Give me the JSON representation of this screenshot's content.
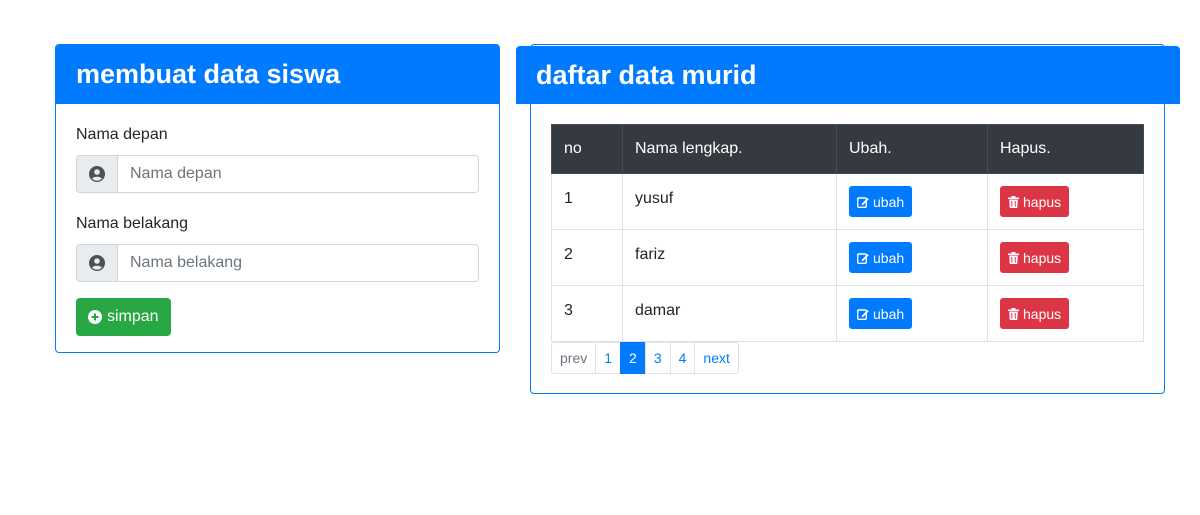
{
  "form_card": {
    "title": "membuat data siswa",
    "first_name": {
      "label": "Nama depan",
      "placeholder": "Nama depan",
      "value": ""
    },
    "last_name": {
      "label": "Nama belakang",
      "placeholder": "Nama belakang",
      "value": ""
    },
    "save_label": "simpan"
  },
  "list_card": {
    "title": "daftar data murid",
    "columns": [
      "no",
      "Nama lengkap.",
      "Ubah.",
      "Hapus."
    ],
    "rows": [
      {
        "no": "1",
        "name": "yusuf",
        "edit": "ubah",
        "delete": "hapus"
      },
      {
        "no": "2",
        "name": "fariz",
        "edit": "ubah",
        "delete": "hapus"
      },
      {
        "no": "3",
        "name": "damar",
        "edit": "ubah",
        "delete": "hapus"
      }
    ],
    "pagination": {
      "items": [
        "prev",
        "1",
        "2",
        "3",
        "4",
        "next"
      ],
      "active": "2"
    }
  },
  "colors": {
    "primary": "#007bff",
    "success": "#28a745",
    "danger": "#dc3545",
    "table_header": "#343a40"
  },
  "icons": {
    "user": "user-circle-icon",
    "save": "plus-circle-icon",
    "edit": "edit-icon",
    "delete": "trash-icon"
  }
}
